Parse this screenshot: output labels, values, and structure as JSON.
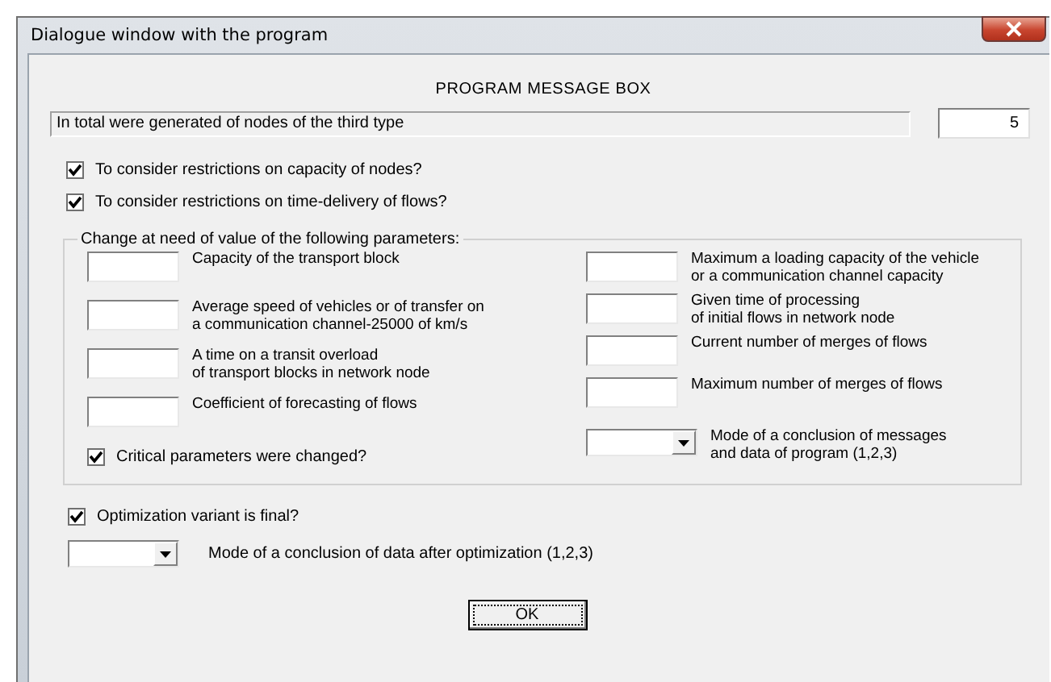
{
  "window": {
    "title": "Dialogue window with the program"
  },
  "heading": "PROGRAM MESSAGE BOX",
  "message": {
    "text": "In total were generated of nodes of the third type",
    "count": "5"
  },
  "options": [
    {
      "label": "To consider restrictions on capacity of nodes?",
      "checked": true
    },
    {
      "label": "To consider restrictions on time-delivery of flows?",
      "checked": true
    }
  ],
  "parameters": {
    "title": "Change at need of value of the following parameters:",
    "left": [
      {
        "kind": "field",
        "label": "Capacity of the transport block"
      },
      {
        "kind": "field",
        "label": "Average speed of vehicles or of transfer on\na communication channel-25000 of km/s"
      },
      {
        "kind": "field",
        "label": "A time on a transit overload\nof transport blocks in network node"
      },
      {
        "kind": "field",
        "label": "Coefficient of forecasting of flows"
      },
      {
        "kind": "checkbox",
        "label": "Critical parameters were changed?",
        "checked": true
      }
    ],
    "right": [
      {
        "kind": "field",
        "label": "Maximum a loading capacity of the vehicle\nor a communication channel capacity"
      },
      {
        "kind": "field",
        "label": "Given time of processing\nof initial flows in network node"
      },
      {
        "kind": "field",
        "label": "Current number of merges of flows"
      },
      {
        "kind": "field",
        "label": "Maximum number of merges of flows"
      },
      {
        "kind": "dropdown",
        "label": "Mode of a conclusion of messages\n and data of program (1,2,3)"
      }
    ]
  },
  "final": {
    "label": "Optimization variant is final?",
    "checked": true
  },
  "output_mode": {
    "label": "Mode of a conclusion of data after optimization (1,2,3)"
  },
  "buttons": [
    "OK"
  ]
}
